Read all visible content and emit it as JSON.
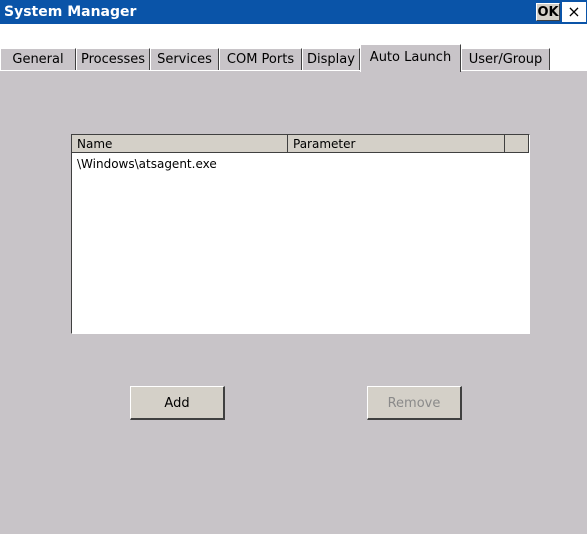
{
  "window": {
    "title": "System Manager",
    "ok_label": "OK",
    "close_label": "×"
  },
  "tabs": [
    {
      "label": "General"
    },
    {
      "label": "Processes"
    },
    {
      "label": "Services"
    },
    {
      "label": "COM Ports"
    },
    {
      "label": "Display"
    },
    {
      "label": "Auto Launch",
      "active": true
    },
    {
      "label": "User/Group"
    }
  ],
  "list": {
    "columns": [
      "Name",
      "Parameter"
    ],
    "rows": [
      {
        "name": "\\Windows\\atsagent.exe",
        "parameter": ""
      }
    ]
  },
  "buttons": {
    "add_label": "Add",
    "remove_label": "Remove"
  }
}
